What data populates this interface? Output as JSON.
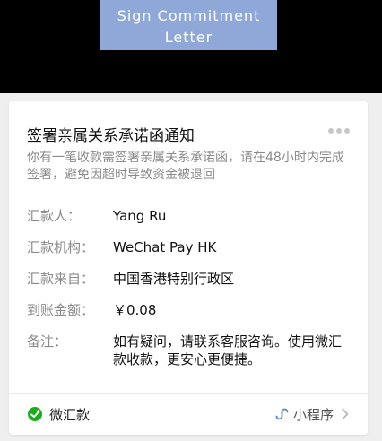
{
  "banner": {
    "text": "Sign Commitment Letter"
  },
  "card": {
    "title": "签署亲属关系承诺函通知",
    "subtitle": "你有一笔收款需签署亲属关系承诺函，请在48小时内完成签署，避免因超时导致资金被退回",
    "rows": [
      {
        "label": "汇款人：",
        "value": "Yang Ru"
      },
      {
        "label": "汇款机构：",
        "value": "WeChat Pay HK"
      },
      {
        "label": "汇款来自：",
        "value": "中国香港特别行政区"
      },
      {
        "label": "到账金额：",
        "value": "￥0.08"
      },
      {
        "label": "备注：",
        "value": "如有疑问，请联系客服咨询。使用微汇款收款，更安心更便捷。"
      }
    ]
  },
  "footer": {
    "brand_label": "微汇款",
    "mini_program_label": "小程序",
    "brand_color": "#1aad19"
  },
  "icons": {
    "more": "more-dots-icon",
    "brand": "wechat-remit-icon",
    "mini_program": "mini-program-icon",
    "chevron": "chevron-right-icon"
  }
}
